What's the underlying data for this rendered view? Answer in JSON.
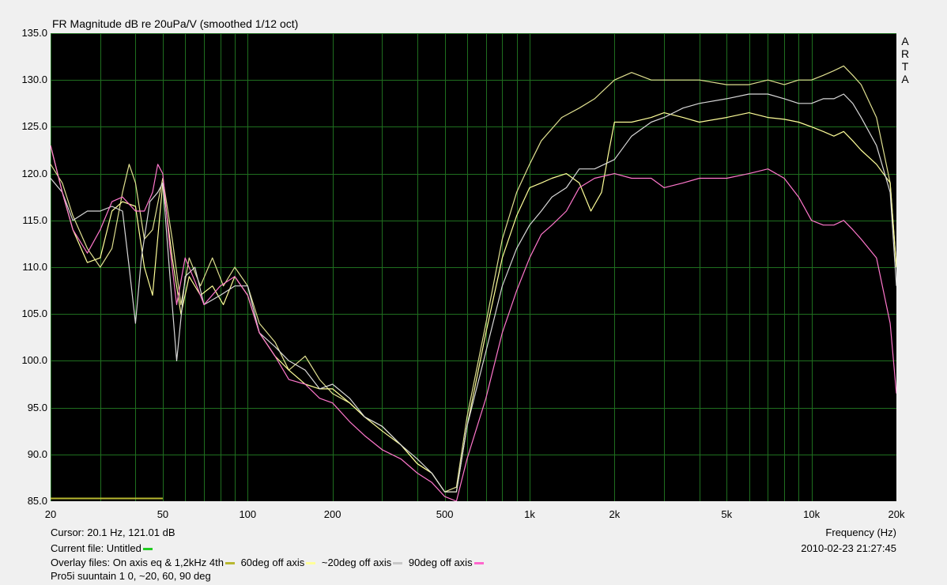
{
  "title": "FR Magnitude dB re 20uPa/V (smoothed 1/12 oct)",
  "watermark": [
    "A",
    "R",
    "T",
    "A"
  ],
  "cursor": "Cursor: 20.1 Hz, 121.01 dB",
  "current_file": "Current file: Untitled",
  "current_file_color": "#22cc22",
  "overlay_label": "Overlay files:",
  "overlays": [
    {
      "name": "On axis eq & 1,2kHz 4th",
      "color": "#b8b830"
    },
    {
      "name": "60deg off axis",
      "color": "#ffff99"
    },
    {
      "name": "~20deg off axis",
      "color": "#c8c8c8"
    },
    {
      "name": "90deg off axis",
      "color": "#ff66cc"
    }
  ],
  "notes": "Pro5i suuntain 1 0, ~20, 60, 90 deg",
  "xlabel": "Frequency (Hz)",
  "timestamp": "2010-02-23  21:27:45",
  "chart_data": {
    "type": "line",
    "title": "FR Magnitude dB re 20uPa/V (smoothed 1/12 oct)",
    "xlabel": "Frequency (Hz)",
    "ylabel": "",
    "xscale": "log",
    "xlim": [
      20,
      20000
    ],
    "ylim": [
      85,
      135
    ],
    "grid": true,
    "yticks": [
      "135.0",
      "130.0",
      "125.0",
      "120.0",
      "115.0",
      "110.0",
      "105.0",
      "100.0",
      "95.0",
      "90.0",
      "85.0"
    ],
    "xticks": [
      {
        "v": 20,
        "label": "20"
      },
      {
        "v": 50,
        "label": "50"
      },
      {
        "v": 100,
        "label": "100"
      },
      {
        "v": 200,
        "label": "200"
      },
      {
        "v": 500,
        "label": "500"
      },
      {
        "v": 1000,
        "label": "1k"
      },
      {
        "v": 2000,
        "label": "2k"
      },
      {
        "v": 5000,
        "label": "5k"
      },
      {
        "v": 10000,
        "label": "10k"
      },
      {
        "v": 20000,
        "label": "20k"
      }
    ],
    "series": [
      {
        "name": "On axis eq & 1,2kHz 4th",
        "color": "#e0e090",
        "points": [
          [
            20,
            121
          ],
          [
            22,
            119
          ],
          [
            24,
            115.5
          ],
          [
            27,
            112
          ],
          [
            30,
            110
          ],
          [
            33,
            112
          ],
          [
            36,
            118
          ],
          [
            38,
            121
          ],
          [
            40,
            119
          ],
          [
            43,
            113
          ],
          [
            46,
            114
          ],
          [
            50,
            119.5
          ],
          [
            54,
            113
          ],
          [
            58,
            106
          ],
          [
            62,
            111
          ],
          [
            68,
            108
          ],
          [
            75,
            111
          ],
          [
            82,
            108
          ],
          [
            90,
            110
          ],
          [
            100,
            108
          ],
          [
            110,
            104
          ],
          [
            125,
            102
          ],
          [
            140,
            99
          ],
          [
            160,
            100.5
          ],
          [
            180,
            98
          ],
          [
            200,
            96.5
          ],
          [
            230,
            95.5
          ],
          [
            260,
            94
          ],
          [
            300,
            93
          ],
          [
            350,
            91
          ],
          [
            400,
            89
          ],
          [
            450,
            88
          ],
          [
            500,
            86
          ],
          [
            550,
            86.5
          ],
          [
            600,
            94
          ],
          [
            700,
            104
          ],
          [
            800,
            113
          ],
          [
            900,
            118
          ],
          [
            1000,
            121
          ],
          [
            1100,
            123.5
          ],
          [
            1300,
            126
          ],
          [
            1500,
            127
          ],
          [
            1700,
            128
          ],
          [
            2000,
            130
          ],
          [
            2300,
            130.8
          ],
          [
            2700,
            130
          ],
          [
            3000,
            130
          ],
          [
            4000,
            130
          ],
          [
            5000,
            129.5
          ],
          [
            6000,
            129.5
          ],
          [
            7000,
            130
          ],
          [
            8000,
            129.5
          ],
          [
            9000,
            130
          ],
          [
            10000,
            130
          ],
          [
            11000,
            130.5
          ],
          [
            12000,
            131
          ],
          [
            13000,
            131.5
          ],
          [
            14000,
            130.5
          ],
          [
            15000,
            129.5
          ],
          [
            17000,
            126
          ],
          [
            19000,
            119
          ],
          [
            20000,
            110
          ]
        ]
      },
      {
        "name": "60deg off axis",
        "color": "#ffff99",
        "points": [
          [
            20,
            123
          ],
          [
            22,
            118
          ],
          [
            24,
            114
          ],
          [
            27,
            110.5
          ],
          [
            30,
            111
          ],
          [
            33,
            116
          ],
          [
            36,
            117
          ],
          [
            40,
            116.5
          ],
          [
            43,
            110
          ],
          [
            46,
            107
          ],
          [
            50,
            119
          ],
          [
            54,
            111
          ],
          [
            58,
            105
          ],
          [
            62,
            109
          ],
          [
            68,
            107
          ],
          [
            75,
            108
          ],
          [
            82,
            106
          ],
          [
            90,
            109
          ],
          [
            100,
            107
          ],
          [
            110,
            103
          ],
          [
            125,
            100.5
          ],
          [
            140,
            99
          ],
          [
            160,
            97.5
          ],
          [
            180,
            97
          ],
          [
            200,
            97
          ],
          [
            230,
            95.5
          ],
          [
            260,
            94
          ],
          [
            300,
            92.5
          ],
          [
            350,
            91
          ],
          [
            400,
            89
          ],
          [
            450,
            88
          ],
          [
            500,
            86
          ],
          [
            550,
            86
          ],
          [
            600,
            93
          ],
          [
            700,
            103
          ],
          [
            800,
            111
          ],
          [
            900,
            115.5
          ],
          [
            1000,
            118.5
          ],
          [
            1100,
            119
          ],
          [
            1200,
            119.5
          ],
          [
            1350,
            120
          ],
          [
            1500,
            119
          ],
          [
            1650,
            116
          ],
          [
            1800,
            118
          ],
          [
            1900,
            122
          ],
          [
            2000,
            125.5
          ],
          [
            2300,
            125.5
          ],
          [
            2700,
            126
          ],
          [
            3000,
            126.5
          ],
          [
            3500,
            126
          ],
          [
            4000,
            125.5
          ],
          [
            5000,
            126
          ],
          [
            6000,
            126.5
          ],
          [
            7000,
            126
          ],
          [
            8000,
            125.8
          ],
          [
            9000,
            125.5
          ],
          [
            10000,
            125
          ],
          [
            11000,
            124.5
          ],
          [
            12000,
            124
          ],
          [
            13000,
            124.5
          ],
          [
            14000,
            123.5
          ],
          [
            15000,
            122.5
          ],
          [
            17000,
            121
          ],
          [
            19000,
            119
          ],
          [
            20000,
            110
          ]
        ]
      },
      {
        "name": "~20deg off axis",
        "color": "#d8d8d8",
        "points": [
          [
            20,
            119.5
          ],
          [
            22,
            118
          ],
          [
            24,
            115
          ],
          [
            27,
            116
          ],
          [
            30,
            116
          ],
          [
            33,
            116.5
          ],
          [
            36,
            116
          ],
          [
            38,
            110
          ],
          [
            40,
            104
          ],
          [
            42,
            111
          ],
          [
            45,
            117
          ],
          [
            48,
            118
          ],
          [
            50,
            119
          ],
          [
            53,
            109
          ],
          [
            56,
            100
          ],
          [
            60,
            109
          ],
          [
            65,
            110
          ],
          [
            70,
            106
          ],
          [
            80,
            107
          ],
          [
            90,
            108
          ],
          [
            100,
            108
          ],
          [
            110,
            103
          ],
          [
            125,
            101.5
          ],
          [
            140,
            100
          ],
          [
            160,
            99
          ],
          [
            180,
            97
          ],
          [
            200,
            97.5
          ],
          [
            230,
            96
          ],
          [
            260,
            94
          ],
          [
            300,
            93
          ],
          [
            350,
            91
          ],
          [
            400,
            89.5
          ],
          [
            450,
            88
          ],
          [
            500,
            86
          ],
          [
            550,
            86
          ],
          [
            600,
            93
          ],
          [
            700,
            101
          ],
          [
            800,
            108
          ],
          [
            900,
            112
          ],
          [
            1000,
            114.5
          ],
          [
            1100,
            116
          ],
          [
            1200,
            117.5
          ],
          [
            1350,
            118.5
          ],
          [
            1500,
            120.5
          ],
          [
            1700,
            120.5
          ],
          [
            2000,
            121.5
          ],
          [
            2300,
            124
          ],
          [
            2700,
            125.5
          ],
          [
            3000,
            126
          ],
          [
            3500,
            127
          ],
          [
            4000,
            127.5
          ],
          [
            5000,
            128
          ],
          [
            6000,
            128.5
          ],
          [
            7000,
            128.5
          ],
          [
            8000,
            128
          ],
          [
            9000,
            127.5
          ],
          [
            10000,
            127.5
          ],
          [
            11000,
            128
          ],
          [
            12000,
            128
          ],
          [
            13000,
            128.5
          ],
          [
            14000,
            127.5
          ],
          [
            15000,
            126
          ],
          [
            17000,
            123
          ],
          [
            19000,
            118
          ],
          [
            20000,
            108
          ]
        ]
      },
      {
        "name": "90deg off axis",
        "color": "#ff77cc",
        "points": [
          [
            20,
            123
          ],
          [
            22,
            118
          ],
          [
            24,
            114
          ],
          [
            27,
            111.5
          ],
          [
            30,
            114
          ],
          [
            33,
            117
          ],
          [
            36,
            117.5
          ],
          [
            40,
            116
          ],
          [
            43,
            116
          ],
          [
            46,
            118
          ],
          [
            48,
            121
          ],
          [
            50,
            120
          ],
          [
            53,
            112
          ],
          [
            56,
            106
          ],
          [
            60,
            111
          ],
          [
            65,
            108.5
          ],
          [
            70,
            106
          ],
          [
            80,
            108
          ],
          [
            90,
            109
          ],
          [
            100,
            107
          ],
          [
            110,
            103
          ],
          [
            125,
            100.5
          ],
          [
            140,
            98
          ],
          [
            160,
            97.5
          ],
          [
            180,
            96
          ],
          [
            200,
            95.5
          ],
          [
            230,
            93.5
          ],
          [
            260,
            92
          ],
          [
            300,
            90.5
          ],
          [
            350,
            89.5
          ],
          [
            400,
            88
          ],
          [
            450,
            87
          ],
          [
            500,
            85.5
          ],
          [
            550,
            85
          ],
          [
            600,
            89.5
          ],
          [
            700,
            96
          ],
          [
            800,
            103
          ],
          [
            900,
            107.5
          ],
          [
            1000,
            111
          ],
          [
            1100,
            113.5
          ],
          [
            1200,
            114.5
          ],
          [
            1350,
            116
          ],
          [
            1500,
            118.5
          ],
          [
            1700,
            119.5
          ],
          [
            2000,
            120
          ],
          [
            2300,
            119.5
          ],
          [
            2700,
            119.5
          ],
          [
            3000,
            118.5
          ],
          [
            3500,
            119
          ],
          [
            4000,
            119.5
          ],
          [
            5000,
            119.5
          ],
          [
            6000,
            120
          ],
          [
            7000,
            120.5
          ],
          [
            8000,
            119.5
          ],
          [
            9000,
            117.5
          ],
          [
            10000,
            115
          ],
          [
            11000,
            114.5
          ],
          [
            12000,
            114.5
          ],
          [
            13000,
            115
          ],
          [
            14000,
            114
          ],
          [
            15000,
            113
          ],
          [
            17000,
            111
          ],
          [
            19000,
            104
          ],
          [
            20000,
            96.5
          ]
        ]
      }
    ]
  }
}
